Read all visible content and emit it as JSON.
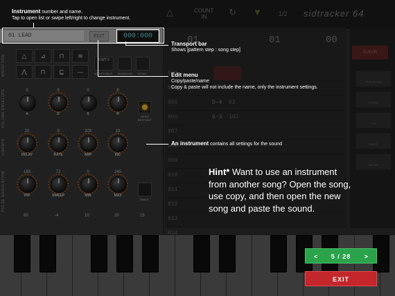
{
  "colors": {
    "nav_green": "#2aa34a",
    "exit_red": "#c3262b",
    "knob_ring": "#b05a1e",
    "led": "#ffcb3a",
    "display_text": "#7ee"
  },
  "topbar": {
    "count_label": "COUNT",
    "count_value": "IN",
    "ratio": "1/2",
    "logo": "sidtracker 64"
  },
  "instrument_header": {
    "name": "01  LEAD",
    "edit_label": "EDIT",
    "transport": "000:000"
  },
  "panel": {
    "sections": {
      "waveform": "WAVEFORM",
      "volume_envelope": "VOLUME ENVELOPE",
      "vibrato": "VIBRATO",
      "pulse_modulation": "PULSE MODULATION"
    },
    "wave_buttons": [
      "WAVETABLE",
      "RINGMOD",
      "SYNC"
    ],
    "wavetable_info": "0.WT 5",
    "envelope": [
      {
        "label": "A",
        "value": "0"
      },
      {
        "label": "D",
        "value": "8"
      },
      {
        "label": "S",
        "value": "0"
      },
      {
        "label": "R",
        "value": "8"
      }
    ],
    "hard_restart": "HARD RESTART",
    "vibrato": [
      {
        "label": "DELAY",
        "value": "20"
      },
      {
        "label": "RATE",
        "value": "9"
      },
      {
        "label": "AMP",
        "value": "203"
      },
      {
        "label": "INC",
        "value": "19"
      }
    ],
    "pulse": [
      {
        "label": "PW",
        "value": "183"
      },
      {
        "label": "SWEEP",
        "value": "72"
      },
      {
        "label": "MIN",
        "value": "0"
      },
      {
        "label": "MAX",
        "value": "245"
      }
    ],
    "table_label": "TABLE",
    "next_row": [
      "80",
      "-4",
      "10",
      "20",
      "15"
    ]
  },
  "song": {
    "pattern_numbers": [
      "01",
      "01",
      "00"
    ],
    "rows": [
      {
        "num": "003",
        "note": "",
        "inst": ""
      },
      {
        "num": "004",
        "note": "",
        "inst": ""
      },
      {
        "num": "005",
        "note": "D-4",
        "inst": "02"
      },
      {
        "num": "006",
        "note": "G-3",
        "inst": "102"
      },
      {
        "num": "007",
        "note": "",
        "inst": ""
      },
      {
        "num": "008",
        "note": "",
        "inst": ""
      },
      {
        "num": "009",
        "note": "",
        "inst": ""
      },
      {
        "num": "010",
        "note": "",
        "inst": ""
      },
      {
        "num": "011",
        "note": "",
        "inst": ""
      },
      {
        "num": "012",
        "note": "",
        "inst": ""
      },
      {
        "num": "013",
        "note": "",
        "inst": ""
      },
      {
        "num": "014",
        "note": "",
        "inst": ""
      }
    ]
  },
  "right_column": {
    "clear": "CLEAR",
    "items": [
      "PLAY ROWS",
      "FILTER",
      "CH",
      "MUTE",
      "NOTES"
    ]
  },
  "help": {
    "instrument": {
      "title": "Instrument",
      "title_rest": " number and name.",
      "body": "Tap to open list or swipe left/right to change instrument."
    },
    "transport": {
      "title": "Transport bar",
      "body": "Shows [pattern step : song step]"
    },
    "edit": {
      "title": "Edit menu",
      "body1": "Copy/paste/name",
      "body2": "Copy & paste will not include the name, only the instrument settings."
    },
    "an_instrument": {
      "title": "An instrument",
      "body": " contains all settings for the sound"
    }
  },
  "hint": {
    "lead": "Hint*",
    "text": " Want to use an instrument from another song? Open the song, use copy, and then open the new song and paste the sound."
  },
  "nav": {
    "prev": "<",
    "page": "5 / 28",
    "next": ">",
    "exit": "EXIT"
  }
}
